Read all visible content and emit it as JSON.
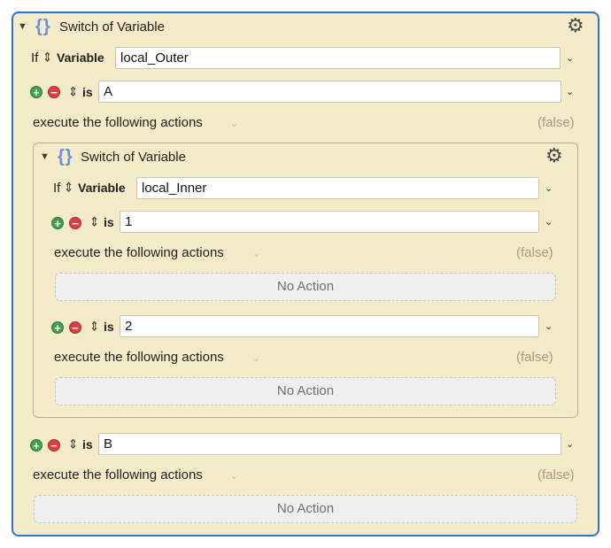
{
  "outer": {
    "title": "Switch of Variable",
    "if_label": "If",
    "variable_label": "Variable",
    "variable_value": "local_Outer",
    "cases": [
      {
        "is_label": "is",
        "value": "A",
        "execute_label": "execute the following actions",
        "false_label": "(false)"
      },
      {
        "is_label": "is",
        "value": "B",
        "execute_label": "execute the following actions",
        "false_label": "(false)",
        "no_action": "No Action"
      }
    ]
  },
  "inner": {
    "title": "Switch of Variable",
    "if_label": "If",
    "variable_label": "Variable",
    "variable_value": "local_Inner",
    "cases": [
      {
        "is_label": "is",
        "value": "1",
        "execute_label": "execute the following actions",
        "false_label": "(false)",
        "no_action": "No Action"
      },
      {
        "is_label": "is",
        "value": "2",
        "execute_label": "execute the following actions",
        "false_label": "(false)",
        "no_action": "No Action"
      }
    ]
  },
  "icons": {
    "disclosure": "chevron-down-icon",
    "braces": "curly-braces-icon",
    "gear": "gear-icon",
    "updown": "up-down-arrows-icon",
    "add": "add-circle-icon",
    "remove": "remove-circle-icon"
  },
  "colors": {
    "panel": "#f4ebc8",
    "selected_border": "#2f6fd6",
    "add": "#3fa14a",
    "remove": "#d94040"
  }
}
